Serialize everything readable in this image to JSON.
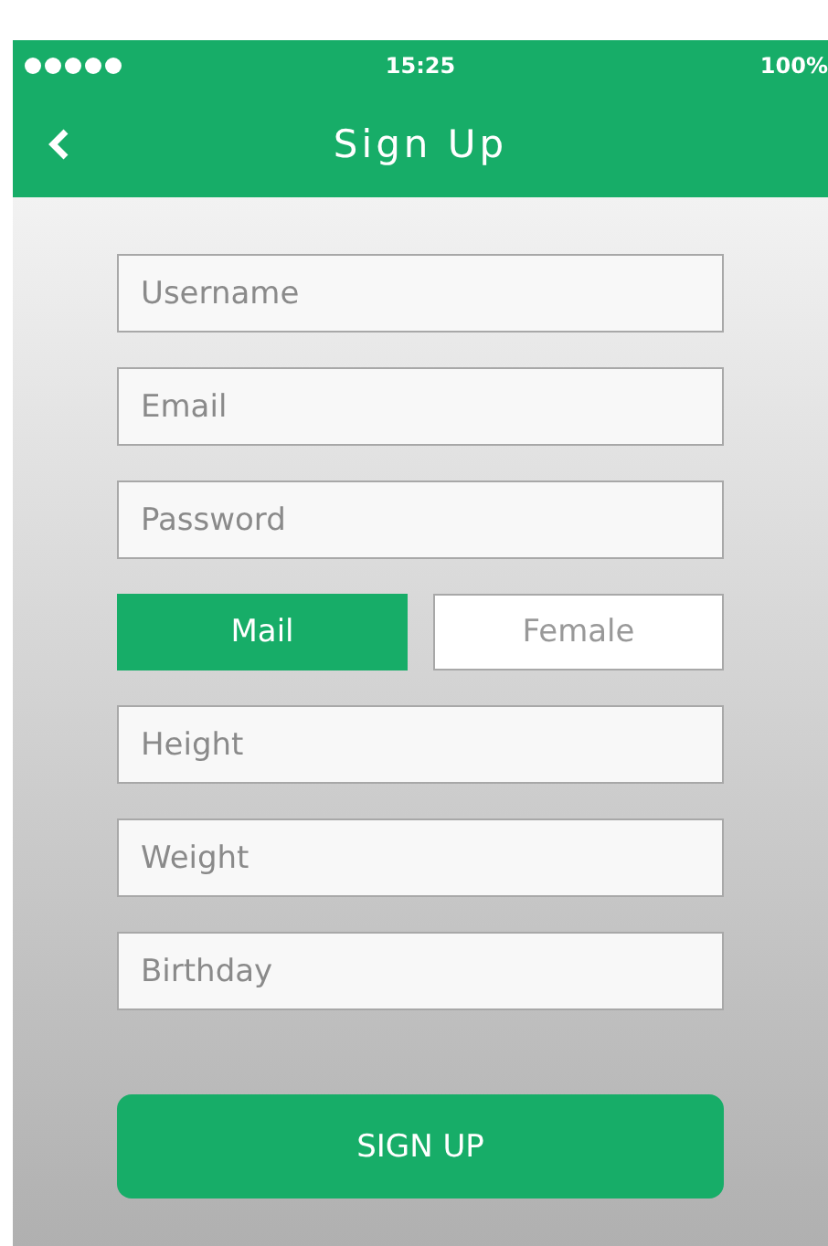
{
  "status_bar": {
    "time": "15:25",
    "battery": "100%"
  },
  "nav": {
    "title": "Sign Up"
  },
  "fields": [
    {
      "placeholder": "Username"
    },
    {
      "placeholder": "Email"
    },
    {
      "placeholder": "Password"
    }
  ],
  "gender": [
    {
      "label": "Mail",
      "selected": true
    },
    {
      "label": "Female",
      "selected": false
    }
  ],
  "fields_2": [
    {
      "placeholder": "Height"
    },
    {
      "placeholder": "Weight"
    },
    {
      "placeholder": "Birthday"
    }
  ],
  "submit": "SIGN UP"
}
